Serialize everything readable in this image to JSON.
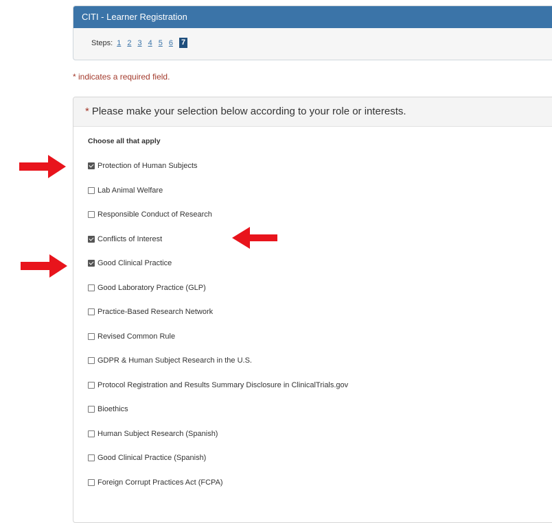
{
  "registration": {
    "title": "CITI - Learner Registration",
    "steps_label": "Steps:",
    "steps": [
      "1",
      "2",
      "3",
      "4",
      "5",
      "6"
    ],
    "current_step": "7"
  },
  "required_note": "* indicates a required field.",
  "selection": {
    "star": "*",
    "prompt": "Please make your selection below according to your role or interests.",
    "choose_label": "Choose all that apply",
    "options": [
      {
        "label": "Protection of Human Subjects",
        "checked": true
      },
      {
        "label": "Lab Animal Welfare",
        "checked": false
      },
      {
        "label": "Responsible Conduct of Research",
        "checked": false
      },
      {
        "label": "Conflicts of Interest",
        "checked": true
      },
      {
        "label": "Good Clinical Practice",
        "checked": true
      },
      {
        "label": "Good Laboratory Practice (GLP)",
        "checked": false
      },
      {
        "label": "Practice-Based Research Network",
        "checked": false
      },
      {
        "label": "Revised Common Rule",
        "checked": false
      },
      {
        "label": "GDPR & Human Subject Research in the U.S.",
        "checked": false
      },
      {
        "label": "Protocol Registration and Results Summary Disclosure in ClinicalTrials.gov",
        "checked": false
      },
      {
        "label": "Bioethics",
        "checked": false
      },
      {
        "label": "Human Subject Research (Spanish)",
        "checked": false
      },
      {
        "label": "Good Clinical Practice (Spanish)",
        "checked": false
      },
      {
        "label": "Foreign Corrupt Practices Act (FCPA)",
        "checked": false
      }
    ]
  },
  "colors": {
    "header_blue": "#3b74a8",
    "current_step": "#1f4f7d",
    "required_red": "#a33a2c",
    "annotation_arrow": "#e8141c"
  }
}
